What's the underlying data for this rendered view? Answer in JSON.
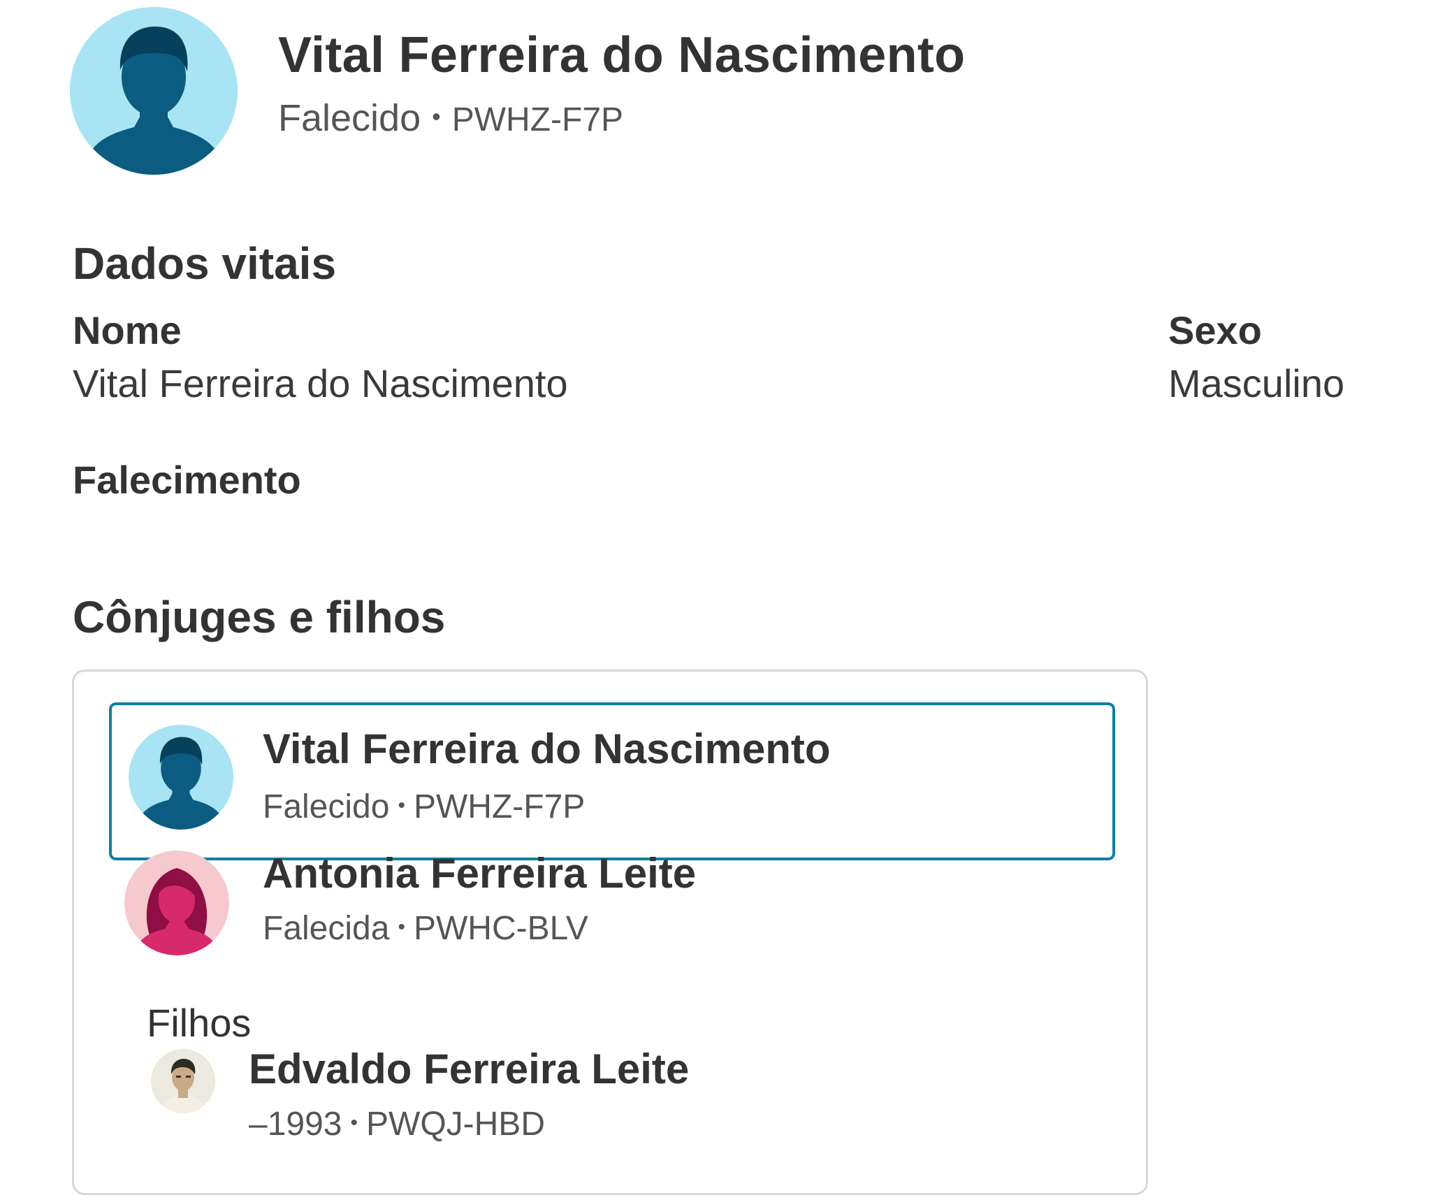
{
  "header": {
    "name": "Vital Ferreira do Nascimento",
    "status": "Falecido",
    "person_id": "PWHZ-F7P",
    "avatar_icon": "male-silhouette-icon"
  },
  "vital_data": {
    "title": "Dados vitais",
    "name_label": "Nome",
    "name_value": "Vital Ferreira do Nascimento",
    "sex_label": "Sexo",
    "sex_value": "Masculino",
    "death_label": "Falecimento"
  },
  "family": {
    "title": "Cônjuges e filhos",
    "children_label": "Filhos",
    "members": [
      {
        "name": "Vital Ferreira do Nascimento",
        "status": "Falecido",
        "person_id": "PWHZ-F7P",
        "avatar_icon": "male-silhouette-icon",
        "selected": true
      },
      {
        "name": "Antonia Ferreira Leite",
        "status": "Falecida",
        "person_id": "PWHC-BLV",
        "avatar_icon": "female-silhouette-icon",
        "selected": false
      }
    ],
    "children": [
      {
        "name": "Edvaldo Ferreira Leite",
        "lifespan": "–1993",
        "person_id": "PWQJ-HBD",
        "avatar_icon": "portrait-photo-icon"
      }
    ]
  },
  "colors": {
    "male_bg": "#a8e4f3",
    "male_fg": "#0b5c80",
    "female_bg": "#f6c9cf",
    "female_fg": "#d62a6a",
    "selected_border": "#0f7fa3"
  }
}
